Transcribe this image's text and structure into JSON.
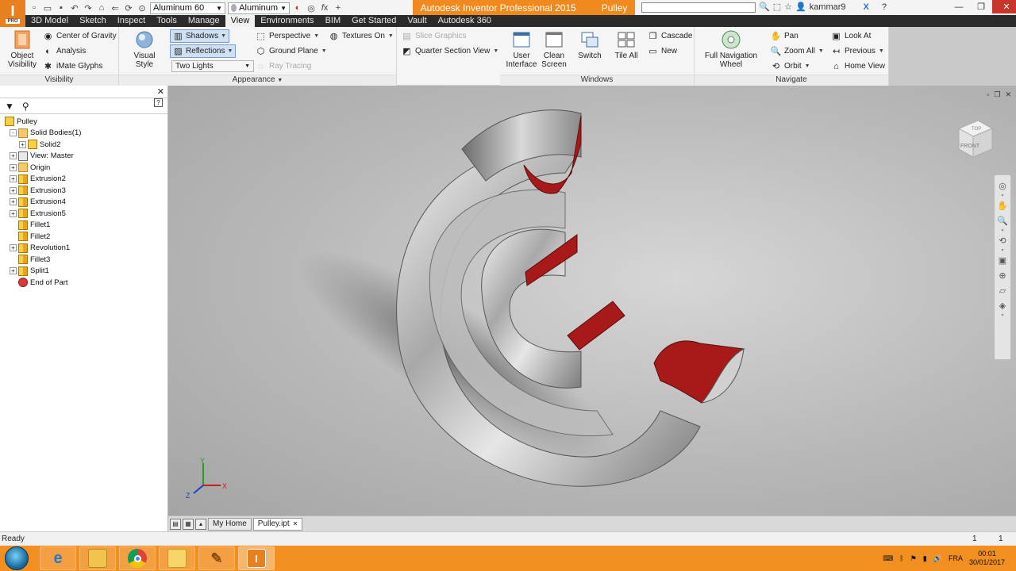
{
  "app": {
    "logo_letter": "I",
    "logo_badge": "PRO",
    "title": "Autodesk Inventor Professional 2015",
    "document": "Pulley"
  },
  "qat": {
    "material_combo": "Aluminum 60",
    "appearance_combo": "Aluminum"
  },
  "titlebar": {
    "user": "kammar9"
  },
  "tabs": [
    "3D Model",
    "Sketch",
    "Inspect",
    "Tools",
    "Manage",
    "View",
    "Environments",
    "BIM",
    "Get Started",
    "Vault",
    "Autodesk 360"
  ],
  "active_tab": "View",
  "ribbon": {
    "visibility": {
      "title": "Visibility",
      "object_visibility": "Object Visibility",
      "center_of_gravity": "Center of Gravity",
      "analysis": "Analysis",
      "imate_glyphs": "iMate Glyphs"
    },
    "appearance": {
      "title": "Appearance",
      "visual_style": "Visual Style",
      "shadows": "Shadows",
      "reflections": "Reflections",
      "lighting": "Two Lights",
      "perspective": "Perspective",
      "ground_plane": "Ground Plane",
      "ray_tracing": "Ray Tracing",
      "textures_on": "Textures On",
      "slice_graphics": "Slice Graphics",
      "quarter_section_view": "Quarter Section View"
    },
    "windows": {
      "title": "Windows",
      "user_interface": "User Interface",
      "clean_screen": "Clean Screen",
      "switch": "Switch",
      "tile_all": "Tile All",
      "cascade": "Cascade",
      "new": "New"
    },
    "navigate": {
      "title": "Navigate",
      "full_navigation_wheel": "Full Navigation Wheel",
      "pan": "Pan",
      "zoom_all": "Zoom All",
      "orbit": "Orbit",
      "look_at": "Look At",
      "previous": "Previous",
      "home_view": "Home View"
    }
  },
  "browser": {
    "help": "?",
    "tree": [
      {
        "label": "Pulley",
        "icon": "part-icon",
        "indent": 0,
        "expand": "none"
      },
      {
        "label": "Solid Bodies(1)",
        "icon": "folder-icon",
        "indent": 1,
        "expand": "-"
      },
      {
        "label": "Solid2",
        "icon": "solid-icon",
        "indent": 2,
        "expand": "+"
      },
      {
        "label": "View: Master",
        "icon": "view-icon",
        "indent": 1,
        "expand": "+"
      },
      {
        "label": "Origin",
        "icon": "folder-icon",
        "indent": 1,
        "expand": "+"
      },
      {
        "label": "Extrusion2",
        "icon": "extrusion-icon",
        "indent": 1,
        "expand": "+"
      },
      {
        "label": "Extrusion3",
        "icon": "extrusion-icon",
        "indent": 1,
        "expand": "+"
      },
      {
        "label": "Extrusion4",
        "icon": "extrusion-icon",
        "indent": 1,
        "expand": "+"
      },
      {
        "label": "Extrusion5",
        "icon": "extrusion-icon",
        "indent": 1,
        "expand": "+"
      },
      {
        "label": "Fillet1",
        "icon": "fillet-icon",
        "indent": 1,
        "expand": "none"
      },
      {
        "label": "Fillet2",
        "icon": "fillet-icon",
        "indent": 1,
        "expand": "none"
      },
      {
        "label": "Revolution1",
        "icon": "revolution-icon",
        "indent": 1,
        "expand": "+"
      },
      {
        "label": "Fillet3",
        "icon": "fillet-icon",
        "indent": 1,
        "expand": "none"
      },
      {
        "label": "Split1",
        "icon": "split-icon",
        "indent": 1,
        "expand": "+"
      },
      {
        "label": "End of Part",
        "icon": "end-of-part-icon",
        "indent": 1,
        "expand": "none"
      }
    ]
  },
  "viewcube": {
    "top": "TOP",
    "front": "FRONT"
  },
  "triad": {
    "x": "X",
    "y": "Y",
    "z": "Z"
  },
  "doc_tabs": {
    "home": "My Home",
    "file": "Pulley.ipt"
  },
  "status": {
    "text": "Ready",
    "count1": "1",
    "count2": "1"
  },
  "taskbar": {
    "apps": [
      "windows-explorer-icon",
      "internet-explorer-icon",
      "file-explorer-icon",
      "chrome-icon",
      "folder-icon",
      "pencil-app-icon",
      "inventor-icon"
    ],
    "language": "FRA",
    "time": "00:01",
    "date": "30/01/2017"
  },
  "colors": {
    "accent_orange": "#f18a1e",
    "section_red": "#b01818",
    "tab_bar": "#2b2b2b"
  }
}
